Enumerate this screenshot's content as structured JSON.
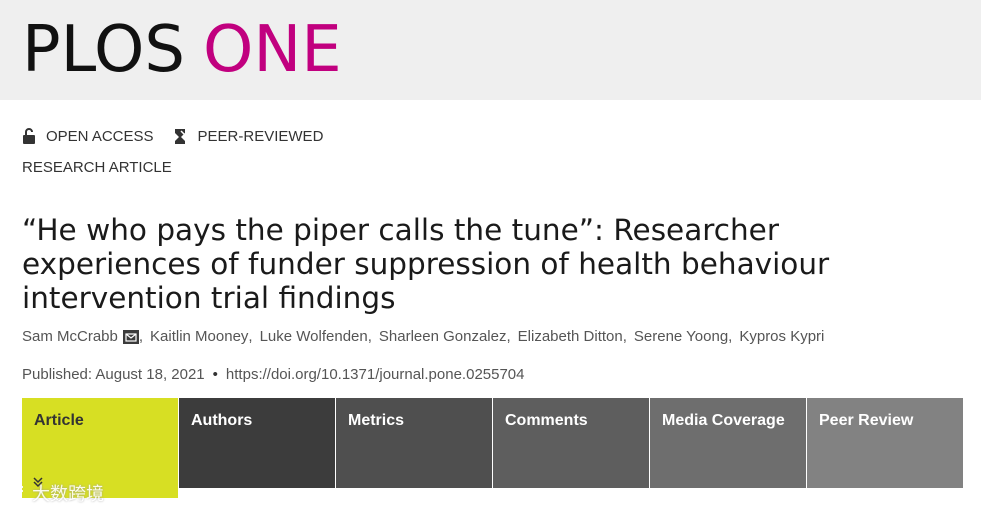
{
  "masthead": {
    "logo_part1": "PLOS",
    "logo_part2": "ONE",
    "brand_color": "#c1007f"
  },
  "badges": {
    "open_access": "OPEN ACCESS",
    "peer_reviewed": "PEER-REVIEWED"
  },
  "article_type": "RESEARCH ARTICLE",
  "title": "“He who pays the piper calls the tune”: Researcher experiences of funder suppression of health behaviour intervention trial findings",
  "authors": [
    "Sam McCrabb",
    "Kaitlin Mooney",
    "Luke Wolfenden",
    "Sharleen Gonzalez",
    "Elizabeth Ditton",
    "Serene Yoong",
    "Kypros Kypri"
  ],
  "published": "Published: August 18, 2021",
  "bullet": "•",
  "doi": "https://doi.org/10.1371/journal.pone.0255704",
  "tabs": [
    "Article",
    "Authors",
    "Metrics",
    "Comments",
    "Media Coverage",
    "Peer Review"
  ],
  "active_tab_color": "#d7df23",
  "watermark": "大数跨境"
}
